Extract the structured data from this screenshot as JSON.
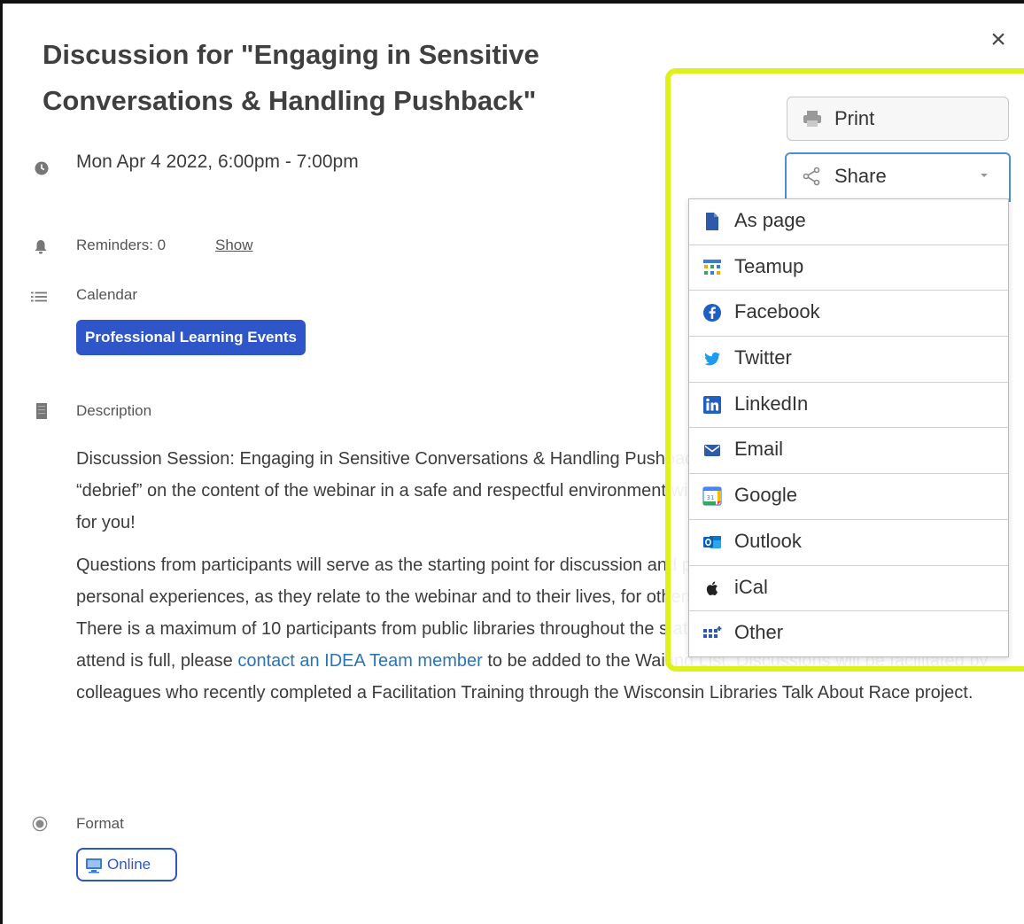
{
  "event": {
    "title": "Discussion for \"Engaging in Sensitive Conversations & Handling Pushback\"",
    "datetime": "Mon Apr 4 2022, 6:00pm - 7:00pm",
    "reminders_label": "Reminders: 0",
    "reminders_show": "Show",
    "calendar_label": "Calendar",
    "calendar_name": "Professional Learning Events",
    "description_label": "Description",
    "description": {
      "p1": "Discussion Session: Engaging in Sensitive Conversations & Handling Pushback This session is an opportunity to “debrief” on the content of the webinar in a safe and respectful environment with colleagues. Choose a time that works for you!",
      "p2_before": "Questions from participants will serve as the starting point for discussion and participants will be encouraged to share personal experiences, as they relate to the webinar and to their lives, for others to reflect on in a non-judgmental space. There is a maximum of 10 participants from public libraries throughout the state. However, if the session you want to attend is full, please ",
      "p2_link": "contact an IDEA Team member",
      "p2_after": " to be added to the Waiting List. Discussions will be facilitated by colleagues who recently completed a Facilitation Training through the Wisconsin Libraries Talk About Race project."
    },
    "format_label": "Format",
    "format_value": "Online"
  },
  "actions": {
    "close": "×",
    "print_label": "Print",
    "share_label": "Share",
    "share_menu": [
      {
        "label": "As page",
        "icon": "page-icon"
      },
      {
        "label": "Teamup",
        "icon": "teamup-icon"
      },
      {
        "label": "Facebook",
        "icon": "facebook-icon"
      },
      {
        "label": "Twitter",
        "icon": "twitter-icon"
      },
      {
        "label": "LinkedIn",
        "icon": "linkedin-icon"
      },
      {
        "label": "Email",
        "icon": "email-icon"
      },
      {
        "label": "Google",
        "icon": "google-calendar-icon"
      },
      {
        "label": "Outlook",
        "icon": "outlook-icon"
      },
      {
        "label": "iCal",
        "icon": "apple-icon"
      },
      {
        "label": "Other",
        "icon": "other-calendar-icon"
      }
    ]
  },
  "colors": {
    "accent": "#2f56c9",
    "link": "#2a74b8",
    "highlight": "#dff11b"
  }
}
